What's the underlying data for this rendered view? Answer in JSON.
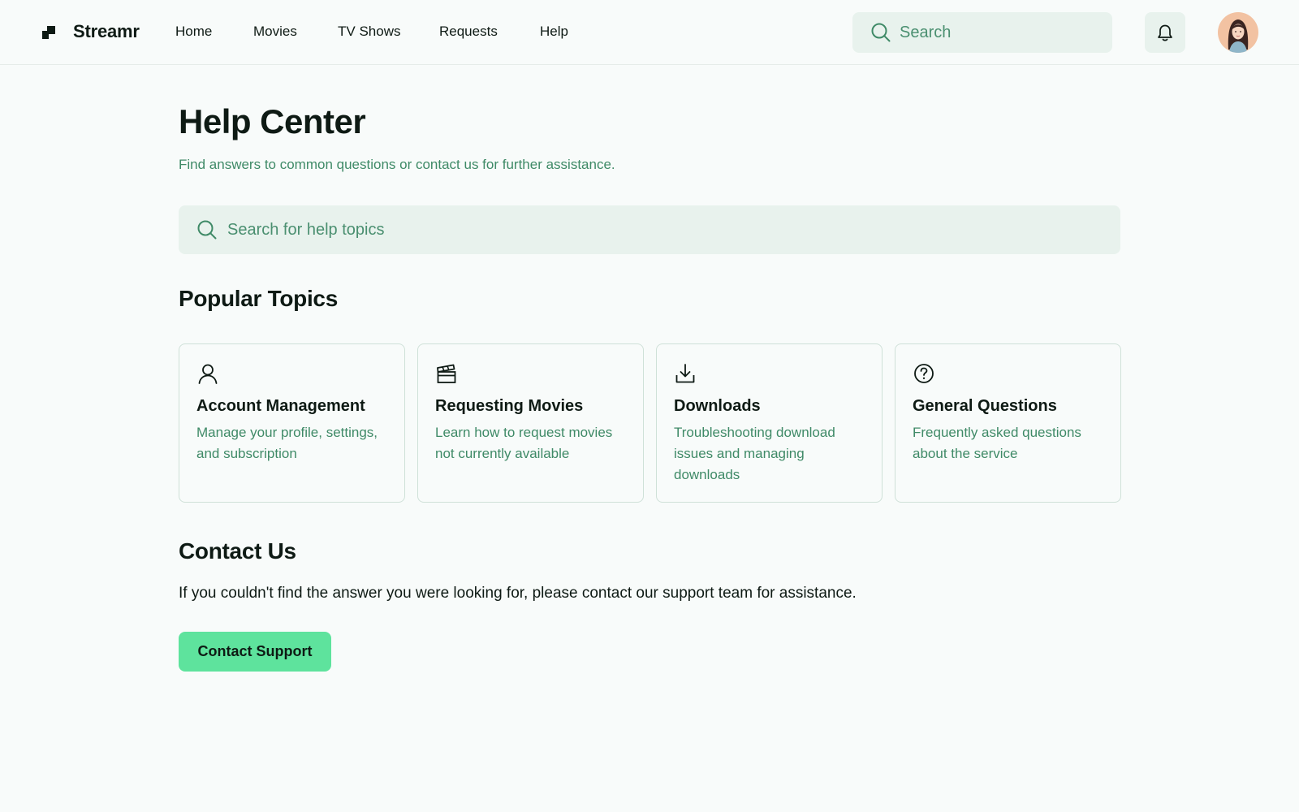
{
  "colors": {
    "background": "#f8fbfa",
    "accent": "#5ee39d",
    "muted_green_text": "#3f8a67",
    "input_background": "#e8f2ed",
    "card_border": "#cfe1d8"
  },
  "header": {
    "logo_icon": "streamr-logo-icon",
    "app_name": "Streamr",
    "nav": [
      {
        "label": "Home"
      },
      {
        "label": "Movies"
      },
      {
        "label": "TV Shows"
      },
      {
        "label": "Requests"
      },
      {
        "label": "Help"
      }
    ],
    "search": {
      "placeholder": "Search",
      "value": "",
      "icon": "search-icon"
    },
    "notifications_icon": "bell-icon",
    "avatar_icon": "user-avatar"
  },
  "main": {
    "title": "Help Center",
    "subtitle": "Find answers to common questions or contact us for further assistance.",
    "help_search": {
      "placeholder": "Search for help topics",
      "value": "",
      "icon": "search-icon"
    },
    "popular_topics": {
      "heading": "Popular Topics",
      "topics": [
        {
          "icon": "user-icon",
          "title": "Account Management",
          "description": "Manage your profile, settings, and subscription"
        },
        {
          "icon": "clapperboard-icon",
          "title": "Requesting Movies",
          "description": "Learn how to request movies not currently available"
        },
        {
          "icon": "download-icon",
          "title": "Downloads",
          "description": "Troubleshooting download issues and managing downloads"
        },
        {
          "icon": "question-circle-icon",
          "title": "General Questions",
          "description": "Frequently asked questions about the service"
        }
      ]
    },
    "contact": {
      "heading": "Contact Us",
      "text": "If you couldn't find the answer you were looking for, please contact our support team for assistance.",
      "button_label": "Contact Support"
    }
  }
}
